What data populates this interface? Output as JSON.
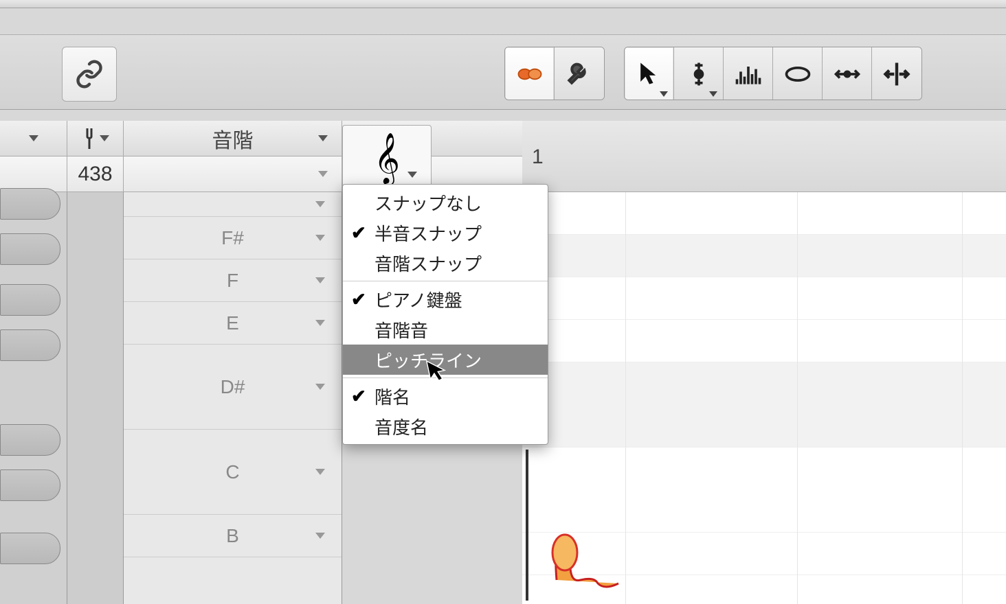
{
  "header": {
    "scale_label": "音階",
    "tuning_value": "438",
    "bar_number": "1"
  },
  "note_labels": [
    "F#",
    "F",
    "E",
    "D#",
    "C",
    "B"
  ],
  "menu": {
    "items": [
      {
        "label": "スナップなし",
        "checked": false
      },
      {
        "label": "半音スナップ",
        "checked": true
      },
      {
        "label": "音階スナップ",
        "checked": false
      }
    ],
    "items2": [
      {
        "label": "ピアノ鍵盤",
        "checked": true
      },
      {
        "label": "音階音",
        "checked": false
      },
      {
        "label": "ピッチライン",
        "checked": false,
        "hovered": true
      }
    ],
    "items3": [
      {
        "label": "階名",
        "checked": true
      },
      {
        "label": "音度名",
        "checked": false
      }
    ]
  },
  "icons": {
    "link": "link-icon",
    "audio": "audio-blobs-icon",
    "wrench": "wrench-icon",
    "pointer": "pointer-tool-icon",
    "pitch": "pitch-tool-icon",
    "pulse": "pulse-tool-icon",
    "oval": "oval-tool-icon",
    "hresize": "hresize-tool-icon",
    "segment": "segment-tool-icon",
    "tuning_fork": "tuning-fork-icon",
    "clef": "treble-clef-icon"
  }
}
